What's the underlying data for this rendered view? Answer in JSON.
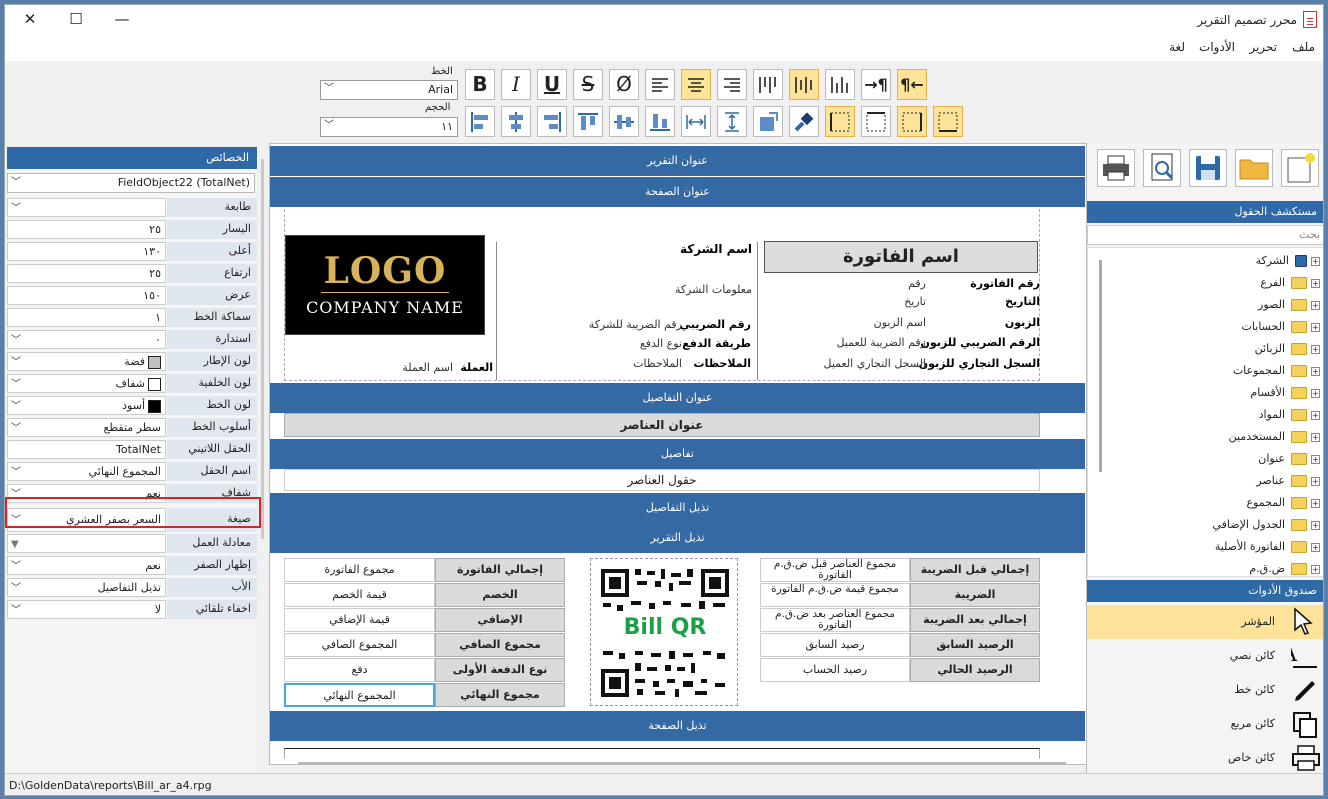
{
  "window": {
    "title": "محرر تصميم التقرير"
  },
  "menu": [
    "ملف",
    "تحرير",
    "الأدوات",
    "لغة"
  ],
  "toolbar": {
    "font_label": "الخط",
    "font_value": "Arial",
    "size_label": "الحجم",
    "size_value": "١١",
    "format_buttons": [
      "B",
      "I",
      "U",
      "S",
      "Ø"
    ]
  },
  "properties": {
    "header": "الخصائص",
    "object_selector": "FieldObject22 (TotalNet)",
    "rows": [
      {
        "label": "طابعة",
        "value": ""
      },
      {
        "label": "اليسار",
        "value": "٢٥"
      },
      {
        "label": "أعلى",
        "value": "١٣٠"
      },
      {
        "label": "ارتفاع",
        "value": "٢٥"
      },
      {
        "label": "عرض",
        "value": "١٥٠"
      },
      {
        "label": "سماكة الخط",
        "value": "١"
      },
      {
        "label": "استدارة",
        "value": "٠"
      },
      {
        "label": "لون الإطار",
        "value": "فضة"
      },
      {
        "label": "لون الخلفية",
        "value": "شفاف"
      },
      {
        "label": "لون الخط",
        "value": "أسود"
      },
      {
        "label": "أسلوب الخط",
        "value": "سطر متقطع"
      },
      {
        "label": "الحقل اللاتيني",
        "value": "TotalNet"
      },
      {
        "label": "اسم الحقل",
        "value": "المجموع النهائي"
      },
      {
        "label": "شفاف",
        "value": "نعم"
      },
      {
        "label": "صيغة",
        "value": "السعر بصفر العشري"
      },
      {
        "label": "معادلة العمل",
        "value": ""
      },
      {
        "label": "إظهار الصفر",
        "value": "نعم"
      },
      {
        "label": "الأب",
        "value": "تذيل التفاصيل"
      },
      {
        "label": "اخفاء تلقائي",
        "value": "لا"
      }
    ],
    "colors": {
      "frame": "#c0c0c0",
      "background": "#ffffff",
      "font": "#000000"
    }
  },
  "bands": {
    "report_title": "عنوان التقرير",
    "page_title": "عنوان الصفحة",
    "details_title": "عنوان التفاصيل",
    "details": "تفاصيل",
    "details_footer": "تذيل التفاصيل",
    "report_footer": "تذيل التقرير",
    "page_footer": "تذيل الصفحة"
  },
  "logo": {
    "main": "LOGO",
    "sub": "COMPANY NAME"
  },
  "invoice_header": {
    "invoice_name": "اسم الفاتورة",
    "company_name": "اسم الشركة",
    "company_info": "معلومات الشركة",
    "left_labels": [
      "رقم الفاتورة",
      "التاريخ",
      "الزبون",
      "الرقم الضريبي للزبون",
      "السجل التجاري للزبون"
    ],
    "left_values": [
      "رقم",
      "تاريخ",
      "اسم الزبون",
      "رقم الضريبة للعميل",
      "السجل التجاري العميل"
    ],
    "mid_labels": [
      "رقم الضريبي",
      "طريقة الدفع",
      "الملاحظات"
    ],
    "mid_values": [
      "رقم الضريبة للشركة",
      "نوع الدفع",
      "الملاحظات"
    ],
    "currency_label": "العملة",
    "currency_value": "اسم العملة"
  },
  "details_title_text": "عنوان العناصر",
  "details_fields_text": "حقول العناصر",
  "totals_right": {
    "labels": [
      "إجمالي قبل الضريبة",
      "الضريبة",
      "إجمالي بعد الضريبة",
      "الرصيد السابق",
      "الرصيد الحالي"
    ],
    "values": [
      "مجموع العناصر قبل ض.ق.م الفاتورة",
      "مجموع قيمة ض.ق.م الفاتورة",
      "مجموع العناصر بعد ض.ق.م الفاتورة",
      "رصيد السابق",
      "رصيد الحساب"
    ]
  },
  "totals_left": {
    "labels": [
      "إجمالي الفاتورة",
      "الخصم",
      "الإضافي",
      "مجموع الصافي",
      "نوع الدفعة الأولى",
      "مجموع النهائي"
    ],
    "values": [
      "مجموع الفاتورة",
      "قيمة الخصم",
      "قيمة الإضافي",
      "المجموع الصافي",
      "دفع",
      "المجموع النهائي"
    ]
  },
  "qr": {
    "label": "Bill QR"
  },
  "fields_explorer": {
    "header": "مستكشف الحقول",
    "search_placeholder": "بحث",
    "items": [
      "الشركة",
      "الفرع",
      "الصور",
      "الحسابات",
      "الزبائن",
      "المجموعات",
      "الأقسام",
      "المواد",
      "المستخدمين",
      "عنوان",
      "عناصر",
      "المجموع",
      "الجدول الإضافي",
      "الفاتورة الأصلية",
      "ض.ق.م"
    ]
  },
  "toolbox": {
    "header": "صندوق الأدوات",
    "items": [
      "المؤشر",
      "كائن نصي",
      "كائن خط",
      "كائن مربع",
      "كائن خاص"
    ]
  },
  "status": {
    "path": "D:\\GoldenData\\reports\\Bill_ar_a4.rpg"
  }
}
